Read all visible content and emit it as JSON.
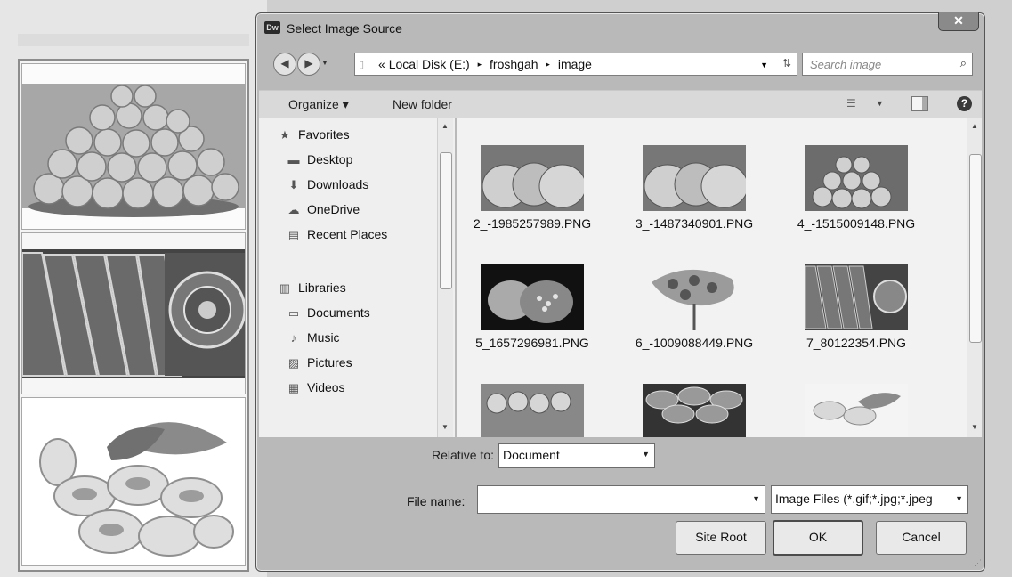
{
  "dialog": {
    "app_icon_text": "Dw",
    "title": "Select Image Source",
    "close_symbol": "✕"
  },
  "address_bar": {
    "overflow": "«",
    "crumbs": [
      "Local Disk (E:)",
      "froshgah",
      "image"
    ],
    "separator": "▸"
  },
  "search": {
    "placeholder": "Search image"
  },
  "toolbar": {
    "organize_label": "Organize ▾",
    "new_folder_label": "New folder"
  },
  "nav_pane": {
    "favorites_header": "Favorites",
    "favorites": [
      "Desktop",
      "Downloads",
      "OneDrive",
      "Recent Places"
    ],
    "libraries_header": "Libraries",
    "libraries": [
      "Documents",
      "Music",
      "Pictures",
      "Videos"
    ]
  },
  "files": [
    {
      "name": "2_-1985257989.PNG",
      "thumb": "pastries-icon"
    },
    {
      "name": "3_-1487340901.PNG",
      "thumb": "pastries-icon"
    },
    {
      "name": "4_-1515009148.PNG",
      "thumb": "fruit-pile-icon"
    },
    {
      "name": "5_1657296981.PNG",
      "thumb": "pomegranate-icon"
    },
    {
      "name": "6_-1009088449.PNG",
      "thumb": "fruit-tree-icon"
    },
    {
      "name": "7_80122354.PNG",
      "thumb": "carpets-icon"
    },
    {
      "name": "",
      "thumb": "fruit-basket-icon"
    },
    {
      "name": "",
      "thumb": "plates-icon"
    },
    {
      "name": "",
      "thumb": "pistachio-icon"
    }
  ],
  "relative_to": {
    "label": "Relative to:",
    "value": "Document"
  },
  "file_name": {
    "label": "File name:",
    "value": ""
  },
  "file_type": {
    "value": "Image Files (*.gif;*.jpg;*.jpeg"
  },
  "buttons": {
    "site_root": "Site Root",
    "ok": "OK",
    "cancel": "Cancel"
  },
  "colors": {
    "window_frame": "#b9b9b9",
    "toolbar": "#d9d9d9",
    "pane": "#efefef"
  }
}
